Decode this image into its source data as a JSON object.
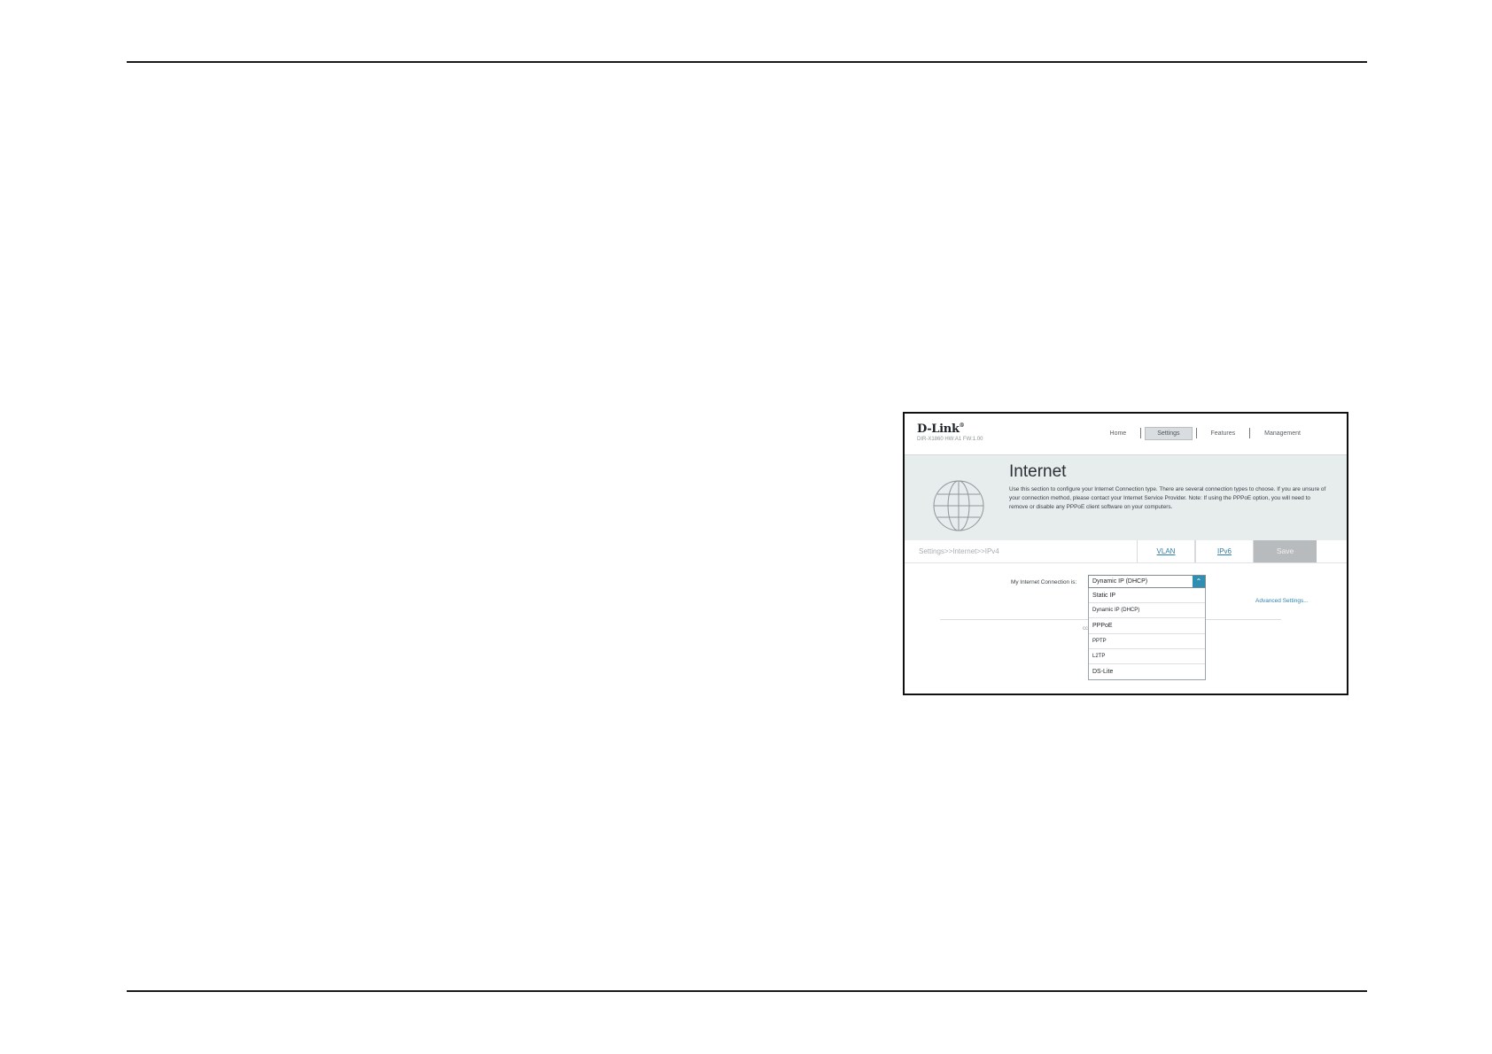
{
  "router_ui": {
    "brand": "D-Link",
    "model": "DIR-X1860 HW:A1 FW:1.00",
    "nav": [
      "Home",
      "Settings",
      "Features",
      "Management"
    ],
    "nav_active": "Settings",
    "page_title": "Internet",
    "page_description": "Use this section to configure your Internet Connection type. There are several connection types to choose. If you are unsure of your connection method, please contact your Internet Service Provider. Note: If using the PPPoE option, you will need to remove or disable any PPPoE client software on your computers.",
    "breadcrumb": "Settings>>Internet>>IPv4",
    "tabs": [
      "VLAN",
      "IPv6"
    ],
    "save_label": "Save",
    "connection_label": "My Internet Connection is:",
    "connection_value": "Dynamic IP (DHCP)",
    "connection_options": [
      "Static IP",
      "Dynamic IP (DHCP)",
      "PPPoE",
      "PPTP",
      "L2TP",
      "DS-Lite"
    ],
    "advanced_link": "Advanced Settings...",
    "obscured_fragment": "cc"
  },
  "colors": {
    "accent": "#2f8fb3",
    "link": "#2f86ad",
    "hero_bg": "#e7eced",
    "save_bg": "#b8bbbd"
  }
}
